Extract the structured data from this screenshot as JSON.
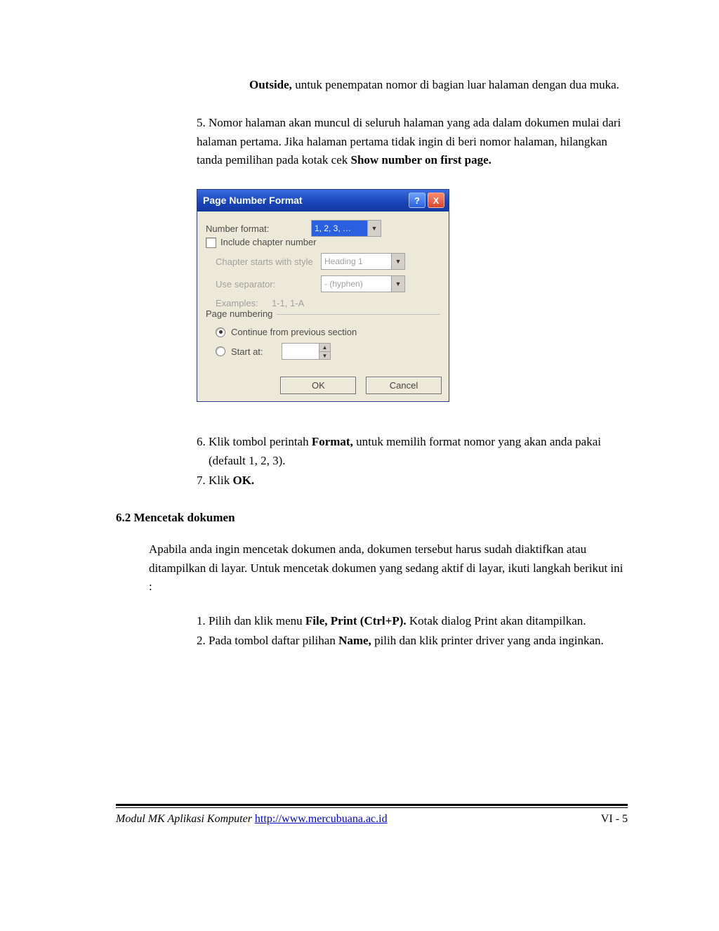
{
  "para_outside": {
    "bold": "Outside,",
    "rest": " untuk penempatan nomor di bagian luar halaman dengan dua muka."
  },
  "item5": {
    "num": "5. ",
    "t1": "Nomor halaman akan muncul di seluruh halaman yang ada dalam dokumen mulai dari halaman pertama. Jika halaman pertama tidak ingin di beri nomor halaman, hilangkan tanda pemilihan pada kotak cek ",
    "b1": "Show number on first page."
  },
  "dialog": {
    "title": "Page Number Format",
    "help": "?",
    "close": "X",
    "number_format_label": "Number format:",
    "number_format_value": "1, 2, 3, …",
    "include_chapter": "Include chapter number",
    "chapter_style_label": "Chapter starts with style",
    "chapter_style_value": "Heading 1",
    "separator_label": "Use separator:",
    "separator_value": "-   (hyphen)",
    "examples_label": "Examples:",
    "examples_value": "1-1, 1-A",
    "page_numbering": "Page numbering",
    "continue_label": "Continue from previous section",
    "start_at_label": "Start at:",
    "ok": "OK",
    "cancel": "Cancel"
  },
  "item6": {
    "num": "6. ",
    "t1": "Klik tombol perintah ",
    "b1": "Format,",
    "t2": " untuk memilih format nomor yang akan anda pakai (default 1, 2, 3)."
  },
  "item7": {
    "num": "7. ",
    "t1": "Klik ",
    "b1": "OK."
  },
  "heading62": "6.2   Mencetak dokumen",
  "para62": "Apabila anda ingin mencetak dokumen anda, dokumen tersebut harus sudah diaktifkan atau ditampilkan di layar. Untuk mencetak dokumen yang sedang aktif di layar, ikuti langkah berikut ini :",
  "l1": {
    "num": "1. ",
    "t1": "Pilih dan klik menu ",
    "b1": "File, Print (Ctrl+P).",
    "t2": " Kotak dialog Print akan ditampilkan."
  },
  "l2": {
    "num": "2. ",
    "t1": "Pada tombol daftar pilihan ",
    "b1": "Name,",
    "t2": " pilih dan klik printer driver yang anda inginkan."
  },
  "footer": {
    "module": "Modul MK Aplikasi Komputer  ",
    "url": "http://www.mercubuana.ac.id",
    "page": "VI - 5"
  }
}
